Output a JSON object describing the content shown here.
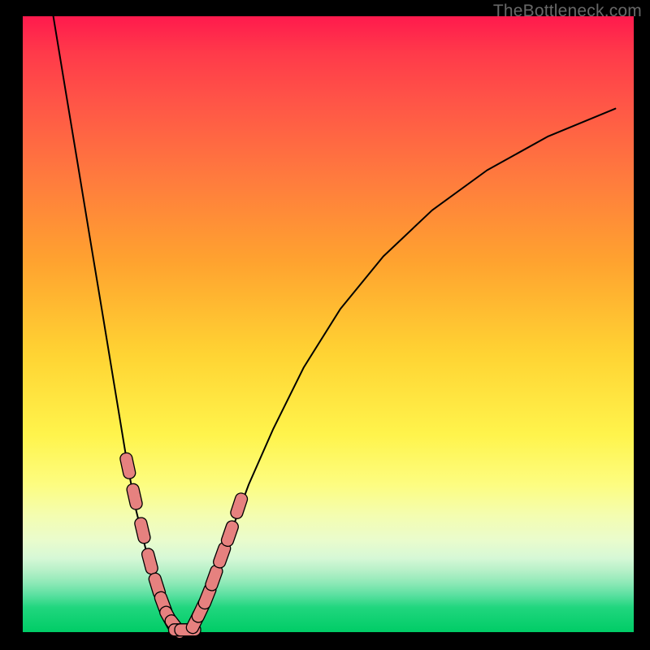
{
  "watermark": {
    "text": "TheBottleneck.com"
  },
  "colors": {
    "gradient_top": "#ff1a4d",
    "gradient_mid": "#fff44c",
    "gradient_bottom": "#00cc66",
    "frame": "#000000",
    "curve": "#000000",
    "marker_fill": "#e6817f",
    "marker_stroke": "#000000",
    "watermark": "#686868"
  },
  "chart_data": {
    "type": "line",
    "title": "",
    "xlabel": "",
    "ylabel": "",
    "xlim": [
      0,
      100
    ],
    "ylim": [
      0,
      100
    ],
    "grid": false,
    "legend": false,
    "annotations": [],
    "series": [
      {
        "name": "left-curve",
        "x": [
          5,
          7,
          9,
          11,
          13,
          15,
          17,
          18.5,
          20,
          21,
          22,
          23,
          24,
          25,
          26
        ],
        "y": [
          100,
          88,
          76,
          64,
          52,
          40,
          28,
          20,
          14,
          10,
          7,
          5,
          3,
          1.5,
          0.5
        ]
      },
      {
        "name": "right-curve",
        "x": [
          27,
          28,
          29,
          30.5,
          32,
          34,
          37,
          41,
          46,
          52,
          59,
          67,
          76,
          86,
          97
        ],
        "y": [
          0.5,
          1.3,
          3,
          6,
          10,
          16,
          24,
          33,
          43,
          52.5,
          61,
          68.5,
          75,
          80.5,
          85
        ]
      }
    ],
    "markers": [
      {
        "name": "left-markers",
        "shape": "rounded-rect",
        "points": [
          {
            "x": 17.2,
            "y": 27
          },
          {
            "x": 18.3,
            "y": 22
          },
          {
            "x": 19.6,
            "y": 16.5
          },
          {
            "x": 20.8,
            "y": 11.5
          },
          {
            "x": 22.0,
            "y": 7.5
          },
          {
            "x": 23.0,
            "y": 4.5
          },
          {
            "x": 24.0,
            "y": 2.2
          },
          {
            "x": 25.0,
            "y": 0.9
          }
        ]
      },
      {
        "name": "bottom-markers",
        "shape": "rounded-rect",
        "points": [
          {
            "x": 26.0,
            "y": 0.35
          },
          {
            "x": 27.0,
            "y": 0.35
          }
        ]
      },
      {
        "name": "right-markers",
        "shape": "rounded-rect",
        "points": [
          {
            "x": 28.3,
            "y": 1.8
          },
          {
            "x": 29.2,
            "y": 3.6
          },
          {
            "x": 30.2,
            "y": 5.8
          },
          {
            "x": 31.3,
            "y": 8.8
          },
          {
            "x": 32.6,
            "y": 12.5
          },
          {
            "x": 33.9,
            "y": 16.0
          },
          {
            "x": 35.4,
            "y": 20.5
          }
        ]
      }
    ]
  }
}
